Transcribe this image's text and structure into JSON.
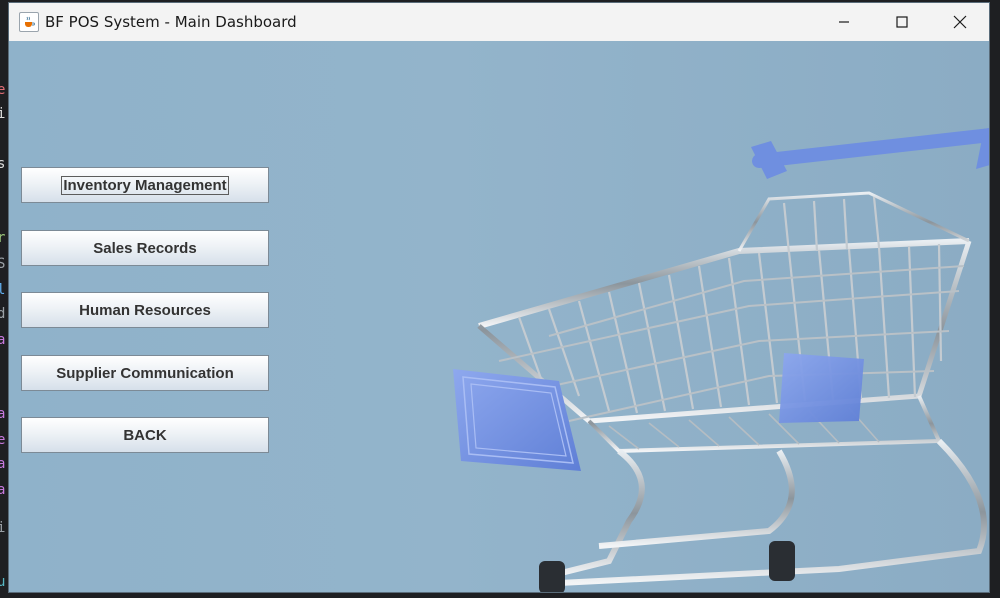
{
  "window": {
    "title": "BF POS System - Main Dashboard",
    "icon": "java-coffee-cup-icon",
    "controls": [
      "minimize-icon",
      "maximize-icon",
      "close-icon"
    ]
  },
  "terminal_glyphs": [
    "e",
    "i",
    "r",
    "s",
    "r",
    "S",
    "l",
    "d",
    "a",
    "a",
    "e",
    "a",
    "a",
    "i",
    "u"
  ],
  "menu": {
    "inventory_label": "Inventory Management",
    "sales_label": "Sales Records",
    "hr_label": "Human Resources",
    "supplier_label": "Supplier Communication",
    "back_label": "BACK"
  },
  "background": {
    "image": "shopping-cart-photo",
    "cart_accent_color": "#6f8fe0"
  }
}
